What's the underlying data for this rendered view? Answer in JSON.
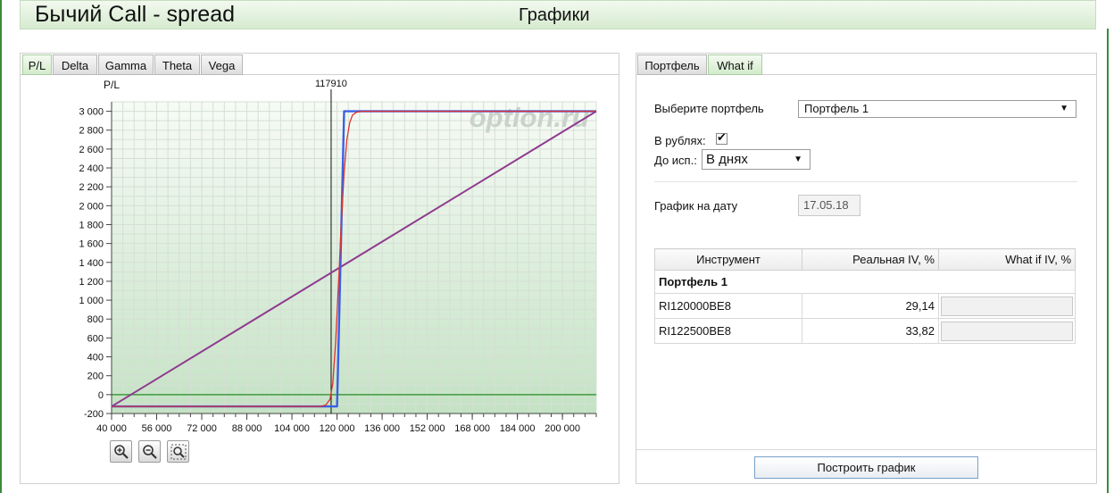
{
  "header": {
    "app_title": "Бычий Call - spread",
    "page_title": "Графики"
  },
  "chart_tabs": [
    {
      "label": "P/L",
      "active": true
    },
    {
      "label": "Delta",
      "active": false
    },
    {
      "label": "Gamma",
      "active": false
    },
    {
      "label": "Theta",
      "active": false
    },
    {
      "label": "Vega",
      "active": false
    }
  ],
  "chart_data": {
    "type": "line",
    "ylabel": "P/L",
    "watermark": "option.ru",
    "marker_label": "117910",
    "marker_x": 117910,
    "xlim": [
      40000,
      212000
    ],
    "ylim": [
      -200,
      3100
    ],
    "x_ticks": [
      40000,
      56000,
      72000,
      88000,
      104000,
      120000,
      136000,
      152000,
      168000,
      184000,
      200000
    ],
    "y_ticks": [
      -200,
      0,
      200,
      400,
      600,
      800,
      1000,
      1200,
      1400,
      1600,
      1800,
      2000,
      2200,
      2400,
      2600,
      2800,
      3000
    ],
    "x_tick_labels": [
      "40 000",
      "56 000",
      "72 000",
      "88 000",
      "104 000",
      "120 000",
      "136 000",
      "152 000",
      "168 000",
      "184 000",
      "200 000"
    ],
    "y_tick_labels": [
      "-200",
      "0",
      "200",
      "400",
      "600",
      "800",
      "1 000",
      "1 200",
      "1 400",
      "1 600",
      "1 800",
      "2 000",
      "2 200",
      "2 400",
      "2 600",
      "2 800",
      "3 000"
    ],
    "series": [
      {
        "role": "expiration",
        "color": "#3a5fe6",
        "x": [
          40000,
          120000,
          122500,
          212000
        ],
        "y": [
          -125,
          -125,
          3000,
          3000
        ]
      },
      {
        "role": "current",
        "color": "#e0302b",
        "x": [
          40000,
          114000,
          116000,
          117500,
          118500,
          119500,
          120500,
          121500,
          122500,
          123500,
          124500,
          125500,
          127000,
          129000,
          212000
        ],
        "y": [
          -125,
          -125,
          -110,
          -50,
          120,
          550,
          1150,
          1800,
          2350,
          2700,
          2880,
          2960,
          2990,
          3000,
          3000
        ]
      },
      {
        "role": "average",
        "color": "#8f3a8f",
        "x": [
          40000,
          212000
        ],
        "y": [
          -125,
          3000
        ]
      }
    ],
    "zero_line_color": "#3f9a3f"
  },
  "zoom": {
    "in_icon": "zoom-in-icon",
    "out_icon": "zoom-out-icon",
    "fit_icon": "zoom-fit-icon"
  },
  "right_tabs": [
    {
      "label": "Портфель",
      "active": false
    },
    {
      "label": "What if",
      "active": true
    }
  ],
  "form": {
    "portfolio_label": "Выберите портфель",
    "portfolio_value": "Портфель 1",
    "rubles_label": "В рублях:",
    "rubles_checked": true,
    "expiry_label": "До исп.:",
    "expiry_value": "В днях",
    "date_label": "График на дату",
    "date_value": "17.05.18"
  },
  "table": {
    "headers": [
      "Инструмент",
      "Реальная IV, %",
      "What if IV, %"
    ],
    "group": "Портфель 1",
    "rows": [
      {
        "instrument": "RI120000BE8",
        "iv": "29,14",
        "whatif": ""
      },
      {
        "instrument": "RI122500BE8",
        "iv": "33,82",
        "whatif": ""
      }
    ]
  },
  "build_button": "Построить график"
}
